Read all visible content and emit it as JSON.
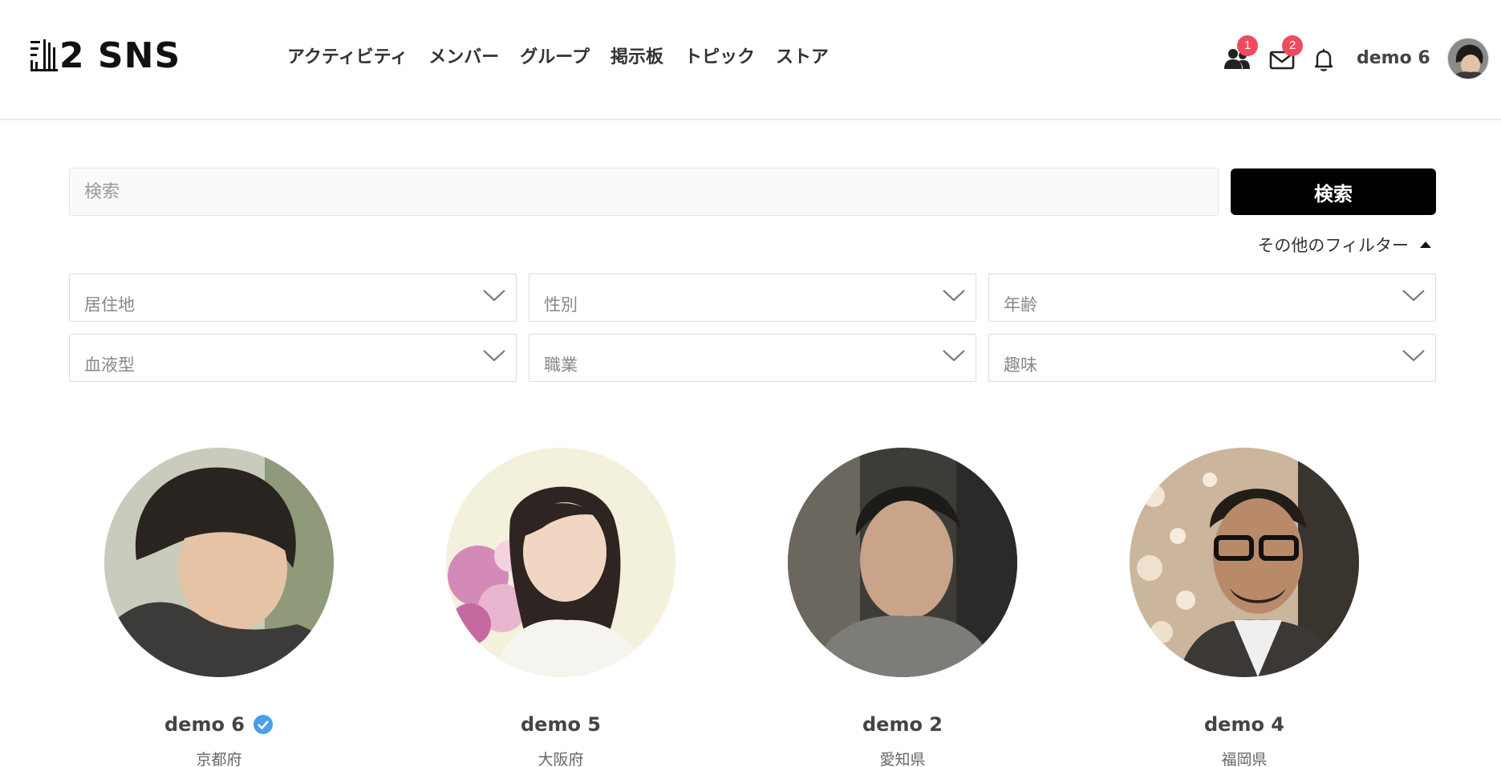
{
  "brand": {
    "name": "2 SNS"
  },
  "nav": {
    "items": [
      {
        "label": "アクティビティ"
      },
      {
        "label": "メンバー"
      },
      {
        "label": "グループ"
      },
      {
        "label": "掲示板"
      },
      {
        "label": "トピック"
      },
      {
        "label": "ストア"
      }
    ]
  },
  "header": {
    "friend_requests_badge": "1",
    "messages_badge": "2",
    "username": "demo 6"
  },
  "search": {
    "placeholder": "検索",
    "button_label": "検索",
    "more_filters_label": "その他のフィルター"
  },
  "filters": [
    {
      "label": "居住地"
    },
    {
      "label": "性別"
    },
    {
      "label": "年齢"
    },
    {
      "label": "血液型"
    },
    {
      "label": "職業"
    },
    {
      "label": "趣味"
    }
  ],
  "members": [
    {
      "name": "demo 6",
      "location": "京都府",
      "verified": true
    },
    {
      "name": "demo 5",
      "location": "大阪府",
      "verified": false
    },
    {
      "name": "demo 2",
      "location": "愛知県",
      "verified": false
    },
    {
      "name": "demo 4",
      "location": "福岡県",
      "verified": false
    }
  ],
  "colors": {
    "badge": "#f04a5e",
    "verified": "#4a9fe8",
    "button": "#000000"
  }
}
